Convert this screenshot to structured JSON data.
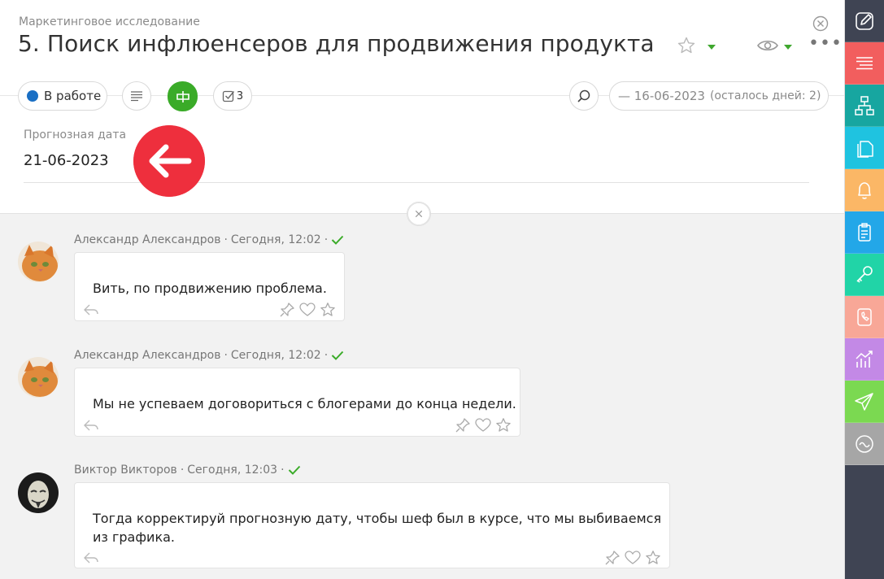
{
  "header": {
    "subtitle": "Маркетинговое исследование",
    "title": "5. Поиск инфлюенсеров для продвижения продукта"
  },
  "toolbar": {
    "status_label": "В работе",
    "status_color": "#1a6fc4",
    "checklist_count": "3",
    "deadline": "— 16-06-2023",
    "remaining": "(осталось дней: 2)"
  },
  "forecast": {
    "label": "Прогнозная дата",
    "value": "21-06-2023"
  },
  "messages": [
    {
      "author": "Александр Александров",
      "time": "Сегодня, 12:02",
      "text": "Вить, по продвижению проблема."
    },
    {
      "author": "Александр Александров",
      "time": "Сегодня, 12:02",
      "text": "Мы не успеваем договориться с блогерами до конца недели."
    },
    {
      "author": "Виктор Викторов",
      "time": "Сегодня, 12:03",
      "text": "Тогда корректируй прогнозную дату, чтобы шеф был в курсе, что мы выбиваемся из графика."
    }
  ],
  "sidebar": {
    "items": [
      {
        "icon": "edit-icon",
        "color": "#3f4453"
      },
      {
        "icon": "menu-lines-icon",
        "color": "#f25e5e"
      },
      {
        "icon": "hierarchy-icon",
        "color": "#17a6a0"
      },
      {
        "icon": "documents-icon",
        "color": "#1fc3e0"
      },
      {
        "icon": "bell-icon",
        "color": "#fbb766"
      },
      {
        "icon": "clipboard-icon",
        "color": "#23a7e8"
      },
      {
        "icon": "key-icon",
        "color": "#21d4a7"
      },
      {
        "icon": "phone-book-icon",
        "color": "#f8a797"
      },
      {
        "icon": "analytics-icon",
        "color": "#c389e6"
      },
      {
        "icon": "send-icon",
        "color": "#7bd951"
      },
      {
        "icon": "wave-icon",
        "color": "#a6a6a6"
      }
    ]
  }
}
